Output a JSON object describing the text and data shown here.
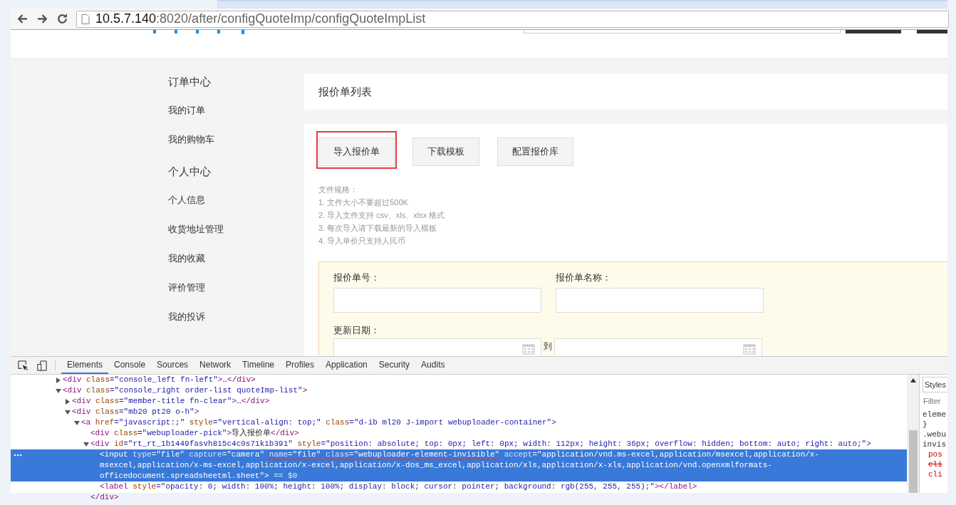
{
  "browser": {
    "url_host": "10.5.7.140",
    "url_path": ":8020/after/configQuoteImp/configQuoteImpList"
  },
  "sidebar": [
    {
      "title": "订单中心",
      "items": [
        "我的订单",
        "我的购物车"
      ]
    },
    {
      "title": "个人中心",
      "items": [
        "个人信息",
        "收货地址管理",
        "我的收藏",
        "评价管理",
        "我的投诉"
      ]
    }
  ],
  "page_title": "报价单列表",
  "buttons": [
    {
      "label": "导入报价单",
      "highlighted": true
    },
    {
      "label": "下载模板",
      "highlighted": false
    },
    {
      "label": "配置报价库",
      "highlighted": false
    }
  ],
  "file_rules": [
    "文件规格：",
    "1. 文件大小不要超过500K",
    "2. 导入文件支持 csv、xls、xlsx 格式",
    "3. 每次导入请下载最新的导入模板",
    "4. 导入单价只支持人民币"
  ],
  "filter": {
    "quote_no_label": "报价单号：",
    "quote_name_label": "报价单名称：",
    "date_label": "更新日期：",
    "date_separator": "到"
  },
  "devtools_tabs": [
    {
      "label": "Elements",
      "selected": true
    },
    {
      "label": "Console",
      "selected": false
    },
    {
      "label": "Sources",
      "selected": false
    },
    {
      "label": "Network",
      "selected": false
    },
    {
      "label": "Timeline",
      "selected": false
    },
    {
      "label": "Profiles",
      "selected": false
    },
    {
      "label": "Application",
      "selected": false
    },
    {
      "label": "Security",
      "selected": false
    },
    {
      "label": "Audits",
      "selected": false
    }
  ],
  "dom_tree": [
    {
      "expanded": false,
      "selected": false,
      "tokens": [
        {
          "kind": "tag",
          "text": "<div"
        },
        {
          "kind": "attr",
          "text": " class"
        },
        {
          "kind": "val",
          "text": "=\"console_left fn-left\""
        },
        {
          "kind": "tag",
          "text": ">"
        },
        {
          "kind": "plain",
          "text": "…"
        },
        {
          "kind": "tag",
          "text": "</div>"
        }
      ]
    },
    {
      "expanded": true,
      "selected": false,
      "tokens": [
        {
          "kind": "tag",
          "text": "<div"
        },
        {
          "kind": "attr",
          "text": " class"
        },
        {
          "kind": "val",
          "text": "=\"console_right order-list quoteImp-list\""
        },
        {
          "kind": "tag",
          "text": ">"
        }
      ],
      "children": [
        {
          "expanded": false,
          "selected": false,
          "tokens": [
            {
              "kind": "tag",
              "text": "<div"
            },
            {
              "kind": "attr",
              "text": " class"
            },
            {
              "kind": "val",
              "text": "=\"member-title fn-clear\""
            },
            {
              "kind": "tag",
              "text": ">"
            },
            {
              "kind": "plain",
              "text": "…"
            },
            {
              "kind": "tag",
              "text": "</div>"
            }
          ]
        },
        {
          "expanded": true,
          "selected": false,
          "tokens": [
            {
              "kind": "tag",
              "text": "<div"
            },
            {
              "kind": "attr",
              "text": " class"
            },
            {
              "kind": "val",
              "text": "=\"mb20 pt20 o-h\""
            },
            {
              "kind": "tag",
              "text": ">"
            }
          ],
          "children": [
            {
              "expanded": true,
              "selected": false,
              "tokens": [
                {
                  "kind": "tag",
                  "text": "<a"
                },
                {
                  "kind": "attr",
                  "text": " href"
                },
                {
                  "kind": "val",
                  "text": "=\"javascript:;\""
                },
                {
                  "kind": "attr",
                  "text": " style"
                },
                {
                  "kind": "val",
                  "text": "=\"vertical-align: top;\""
                },
                {
                  "kind": "attr",
                  "text": " class"
                },
                {
                  "kind": "val",
                  "text": "=\"d-ib ml20 J-import webuploader-container\""
                },
                {
                  "kind": "tag",
                  "text": ">"
                }
              ],
              "children": [
                {
                  "selected": false,
                  "tokens": [
                    {
                      "kind": "tag",
                      "text": "<div"
                    },
                    {
                      "kind": "attr",
                      "text": " class"
                    },
                    {
                      "kind": "val",
                      "text": "=\"webuploader-pick\""
                    },
                    {
                      "kind": "tag",
                      "text": ">"
                    },
                    {
                      "kind": "plain",
                      "text": "导入报价单"
                    },
                    {
                      "kind": "tag",
                      "text": "</div>"
                    }
                  ]
                },
                {
                  "expanded": true,
                  "selected": false,
                  "tokens": [
                    {
                      "kind": "tag",
                      "text": "<div"
                    },
                    {
                      "kind": "attr",
                      "text": " id"
                    },
                    {
                      "kind": "val",
                      "text": "=\"rt_rt_1b1449fasvh815c4c0s71k1b391\""
                    },
                    {
                      "kind": "attr",
                      "text": " style"
                    },
                    {
                      "kind": "val",
                      "text": "=\"position: absolute; top: 0px; left: 0px; width: 112px; height: 36px; overflow: hidden; bottom: auto; right: auto;\""
                    },
                    {
                      "kind": "tag",
                      "text": ">"
                    }
                  ],
                  "close_tokens": [
                    {
                      "kind": "tag",
                      "text": "</div>"
                    }
                  ],
                  "children": [
                    {
                      "selected": true,
                      "tokens": [
                        {
                          "kind": "tag",
                          "text": "<input"
                        },
                        {
                          "kind": "attr",
                          "text": " type"
                        },
                        {
                          "kind": "val",
                          "text": "=\"file\""
                        },
                        {
                          "kind": "attr",
                          "text": " capture"
                        },
                        {
                          "kind": "val",
                          "text": "=\"camera\""
                        },
                        {
                          "kind": "attr",
                          "text": " name",
                          "underlined": true
                        },
                        {
                          "kind": "val",
                          "text": "=\"file\"",
                          "underlined": true
                        },
                        {
                          "kind": "attr",
                          "text": " class",
                          "underlined": true
                        },
                        {
                          "kind": "val",
                          "text": "=\"webuploader-element-invisible\"",
                          "underlined": true
                        },
                        {
                          "kind": "attr",
                          "text": " accept",
                          "underlined": false
                        },
                        {
                          "kind": "val",
                          "text": "=\"application/vnd.ms-excel,application/msexcel,application/x-msexcel,application/x-ms-excel,application/x-excel,application/x-dos_ms_excel,application/xls,application/x-xls,application/vnd.openxmlformats-officedocument.spreadsheetml.sheet\""
                        },
                        {
                          "kind": "tag",
                          "text": ">"
                        },
                        {
                          "kind": "ref",
                          "text": " == $0"
                        }
                      ]
                    },
                    {
                      "selected": false,
                      "tokens": [
                        {
                          "kind": "tag",
                          "text": "<label"
                        },
                        {
                          "kind": "attr",
                          "text": " style"
                        },
                        {
                          "kind": "val",
                          "text": "=\"opacity: 0; width: 100%; height: 100%; display: block; cursor: pointer; background: rgb(255, 255, 255);\""
                        },
                        {
                          "kind": "tag",
                          "text": ">"
                        },
                        {
                          "kind": "tag",
                          "text": "</label>"
                        }
                      ]
                    }
                  ]
                }
              ]
            }
          ]
        }
      ]
    }
  ],
  "styles_panel": {
    "tab": "Styles",
    "filter_placeholder": "Filter",
    "lines": [
      {
        "text": "eleme",
        "kind": "selector",
        "struck": false
      },
      {
        "text": "}",
        "kind": "selector",
        "struck": false
      },
      {
        "text": ".webu",
        "kind": "selector",
        "struck": false
      },
      {
        "text": "invis",
        "kind": "selector",
        "struck": false
      },
      {
        "text": "pos",
        "kind": "prop",
        "struck": false
      },
      {
        "text": "cli",
        "kind": "prop",
        "struck": true
      },
      {
        "text": "cli",
        "kind": "prop",
        "struck": false
      }
    ]
  }
}
